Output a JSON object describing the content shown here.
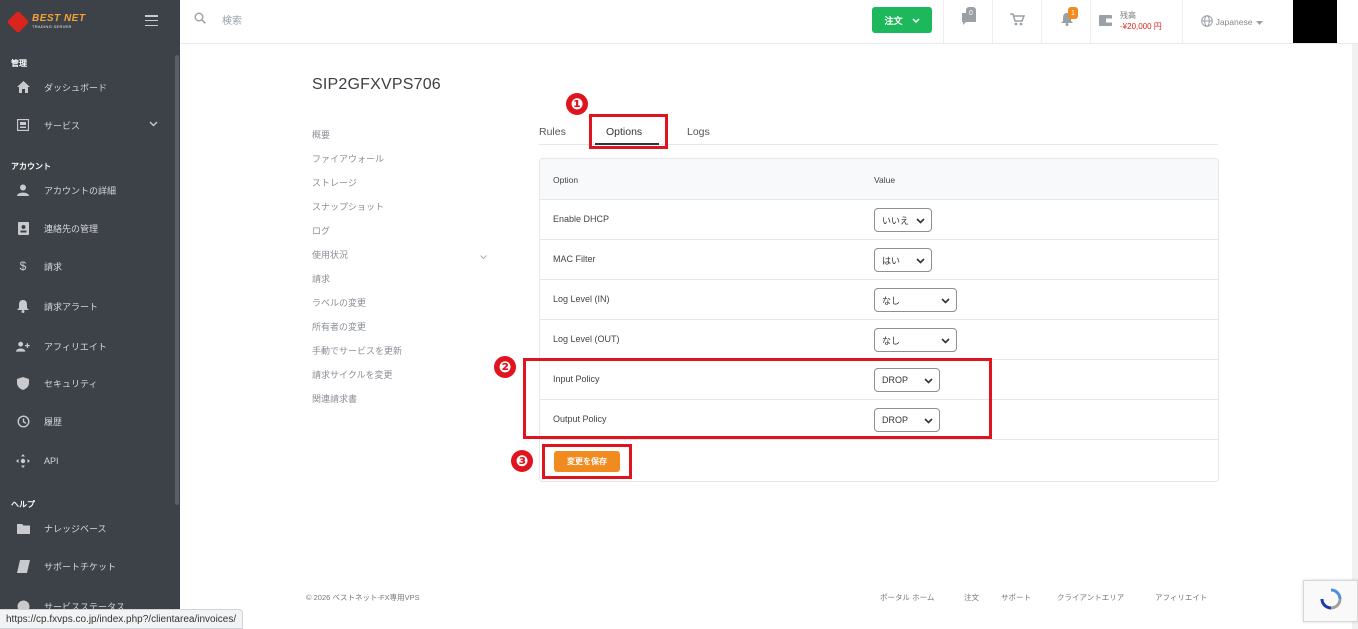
{
  "sidebar": {
    "logo_title": "BEST NET",
    "logo_subtitle": "TRADING SERVER",
    "sections": {
      "admin": "管理",
      "account": "アカウント",
      "help": "ヘルプ"
    },
    "items": [
      {
        "label": "ダッシュボード",
        "icon": "home-icon"
      },
      {
        "label": "サービス",
        "icon": "service-icon"
      },
      {
        "label": "アカウントの詳細",
        "icon": "user-icon"
      },
      {
        "label": "連絡先の管理",
        "icon": "contact-icon"
      },
      {
        "label": "請求",
        "icon": "dollar-icon"
      },
      {
        "label": "請求アラート",
        "icon": "bell-icon"
      },
      {
        "label": "アフィリエイト",
        "icon": "affiliate-icon"
      },
      {
        "label": "セキュリティ",
        "icon": "shield-icon"
      },
      {
        "label": "履歴",
        "icon": "history-icon"
      },
      {
        "label": "API",
        "icon": "api-icon"
      },
      {
        "label": "ナレッジベース",
        "icon": "folder-icon"
      },
      {
        "label": "サポートチケット",
        "icon": "ticket-icon"
      },
      {
        "label": "サービスステータス",
        "icon": "info-icon"
      }
    ]
  },
  "header": {
    "search_placeholder": "検索",
    "order_label": "注文",
    "messages_count": "0",
    "notifications_count": "1",
    "balance_label": "残高",
    "balance_value": "-¥20,000 円",
    "language": "Japanese"
  },
  "page": {
    "title": "SIP2GFXVPS706",
    "subnav": [
      "概要",
      "ファイアウォール",
      "ストレージ",
      "スナップショット",
      "ログ",
      "使用状況",
      "請求",
      "ラベルの変更",
      "所有者の変更",
      "手動でサービスを更新",
      "請求サイクルを変更",
      "関連請求書"
    ]
  },
  "tabs": [
    "Rules",
    "Options",
    "Logs"
  ],
  "table": {
    "columns": [
      "Option",
      "Value"
    ],
    "rows": [
      {
        "option": "Enable DHCP",
        "value": "いいえ"
      },
      {
        "option": "MAC Filter",
        "value": "はい"
      },
      {
        "option": "Log Level (IN)",
        "value": "なし"
      },
      {
        "option": "Log Level (OUT)",
        "value": "なし"
      },
      {
        "option": "Input Policy",
        "value": "DROP"
      },
      {
        "option": "Output Policy",
        "value": "DROP"
      }
    ]
  },
  "save_label": "変更を保存",
  "annotations": [
    "❶",
    "❷",
    "❸"
  ],
  "footer": {
    "copyright": "© 2026 ベストネット-FX専用VPS",
    "links": [
      "ポータル ホーム",
      "注文",
      "サポート",
      "クライアントエリア",
      "アフィリエイト"
    ]
  },
  "status_url": "https://cp.fxvps.co.jp/index.php?/clientarea/invoices/",
  "colors": {
    "sidebar": "#3d4148",
    "order": "#1eb85c",
    "save": "#f28b1f",
    "annotation": "#e0141e",
    "balance": "#d9251d"
  }
}
